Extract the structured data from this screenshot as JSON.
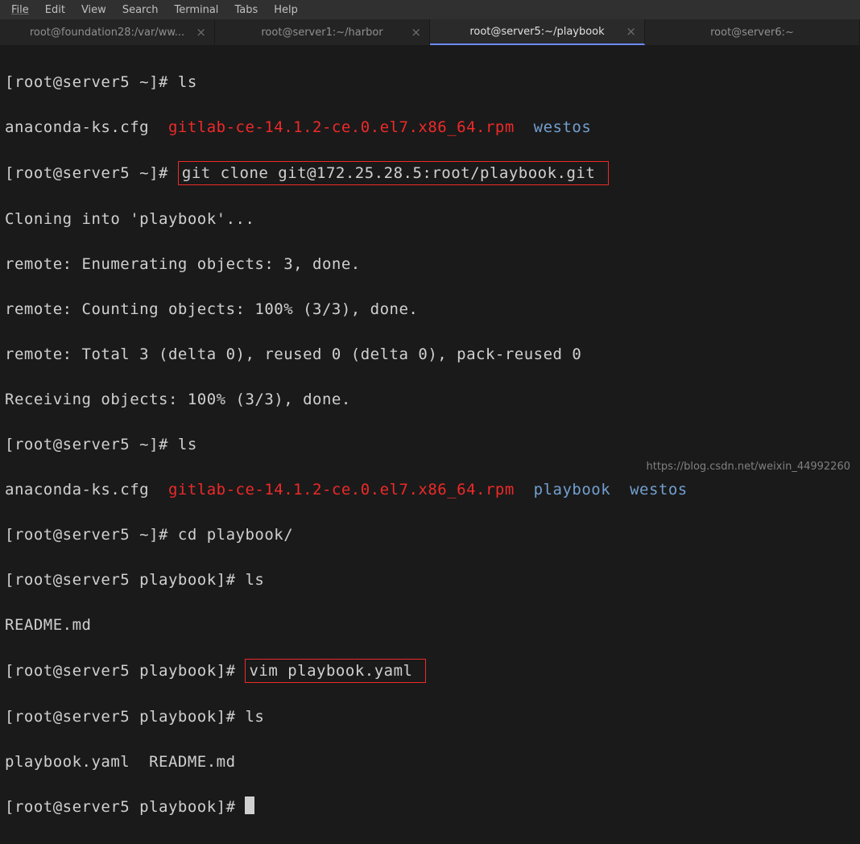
{
  "menubar": {
    "items": [
      "File",
      "Edit",
      "View",
      "Search",
      "Terminal",
      "Tabs",
      "Help"
    ]
  },
  "tabs": [
    {
      "label": "root@foundation28:/var/ww...",
      "active": false
    },
    {
      "label": "root@server1:~/harbor",
      "active": false
    },
    {
      "label": "root@server5:~/playbook",
      "active": true
    },
    {
      "label": "root@server6:~",
      "active": false
    }
  ],
  "terminal": {
    "l1_prompt": "[root@server5 ~]# ",
    "l1_cmd": "ls",
    "l2_file1": "anaconda-ks.cfg  ",
    "l2_file2": "gitlab-ce-14.1.2-ce.0.el7.x86_64.rpm",
    "l2_sp": "  ",
    "l2_file3": "westos",
    "l3_prompt": "[root@server5 ~]# ",
    "l3_cmd": "git clone git@172.25.28.5:root/playbook.git ",
    "l4": "Cloning into 'playbook'...",
    "l5": "remote: Enumerating objects: 3, done.",
    "l6": "remote: Counting objects: 100% (3/3), done.",
    "l7": "remote: Total 3 (delta 0), reused 0 (delta 0), pack-reused 0",
    "l8": "Receiving objects: 100% (3/3), done.",
    "l9_prompt": "[root@server5 ~]# ",
    "l9_cmd": "ls",
    "l10_file1": "anaconda-ks.cfg  ",
    "l10_file2": "gitlab-ce-14.1.2-ce.0.el7.x86_64.rpm",
    "l10_sp1": "  ",
    "l10_file3": "playbook",
    "l10_sp2": "  ",
    "l10_file4": "westos",
    "l11_prompt": "[root@server5 ~]# ",
    "l11_cmd": "cd playbook/",
    "l12_prompt": "[root@server5 playbook]# ",
    "l12_cmd": "ls",
    "l13": "README.md",
    "l14_prompt": "[root@server5 playbook]# ",
    "l14_cmd": "vim playbook.yaml ",
    "l15_prompt": "[root@server5 playbook]# ",
    "l15_cmd": "ls",
    "l16": "playbook.yaml  README.md",
    "l17_prompt": "[root@server5 playbook]# "
  },
  "watermark": "https://blog.csdn.net/weixin_44992260"
}
